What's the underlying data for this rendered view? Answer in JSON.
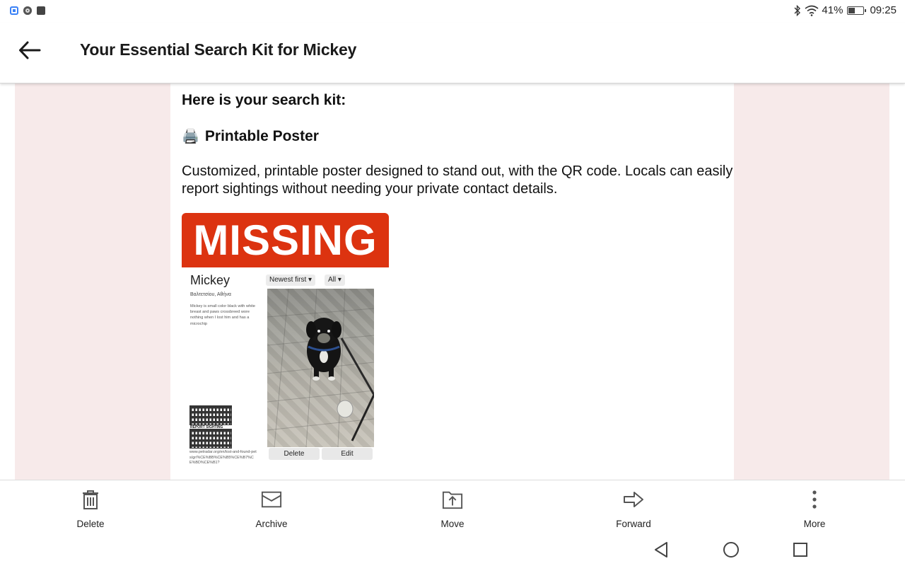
{
  "status_bar": {
    "notification_icons": [
      "app-icon",
      "chrome-icon",
      "facebook-icon"
    ],
    "battery_percent": "41%",
    "battery_level": 0.41,
    "time": "09:25"
  },
  "header": {
    "title": "Your Essential Search Kit for Mickey",
    "back_icon": "arrow-left-icon"
  },
  "email": {
    "kit_heading": "Here is your search kit:",
    "poster_emoji": "🖨️",
    "poster_heading": "Printable Poster",
    "poster_description": "Customized, printable poster designed to stand out, with the QR code. Locals can easily report sightings without needing your private contact details.",
    "poster": {
      "banner": "MISSING",
      "pet_name": "Mickey",
      "location": "Βαλτετσίου, Αθήνα",
      "description": "Mickey is small color black with white breast and paws crossbreed wore nothing when I lost him and has a microchip",
      "qr_label": "REPORT SIGHTING",
      "url": "www.petradar.org/en/lost-and-found-pets/gr/%CE%BB%CE%B5%CE%B7%CE%BD%CE%B1?",
      "sort_label": "Newest first ▾",
      "filter_label": "All ▾",
      "delete_label": "Delete",
      "edit_label": "Edit"
    }
  },
  "actions": [
    {
      "label": "Delete",
      "icon": "trash-icon"
    },
    {
      "label": "Archive",
      "icon": "archive-icon"
    },
    {
      "label": "Move",
      "icon": "move-icon"
    },
    {
      "label": "Forward",
      "icon": "forward-icon"
    },
    {
      "label": "More",
      "icon": "more-icon"
    }
  ],
  "nav": [
    "back-triangle-icon",
    "home-circle-icon",
    "recents-square-icon"
  ],
  "colors": {
    "missing_red": "#dc3310",
    "pink_background": "#f7eaea"
  }
}
